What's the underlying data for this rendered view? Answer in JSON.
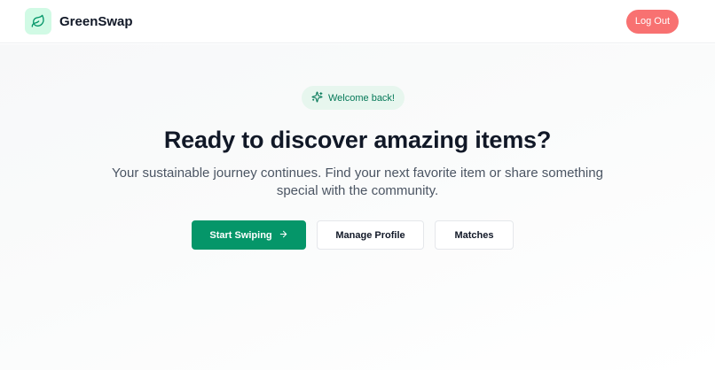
{
  "header": {
    "brand_name": "GreenSwap",
    "logo_icon": "leaf-icon",
    "logout_label": "Log Out"
  },
  "hero": {
    "badge_icon": "sparkles-icon",
    "badge_text": "Welcome back!",
    "title": "Ready to discover amazing items?",
    "subtitle": "Your sustainable journey continues. Find your next favorite item or share something special with the community."
  },
  "actions": {
    "start_swiping_label": "Start Swiping",
    "start_swiping_icon": "arrow-right-icon",
    "manage_profile_label": "Manage Profile",
    "matches_label": "Matches"
  },
  "colors": {
    "brand_green": "#059669",
    "logout_red": "#f87171",
    "badge_bg": "#e7f6ee",
    "logo_bg": "#d1fae5"
  }
}
